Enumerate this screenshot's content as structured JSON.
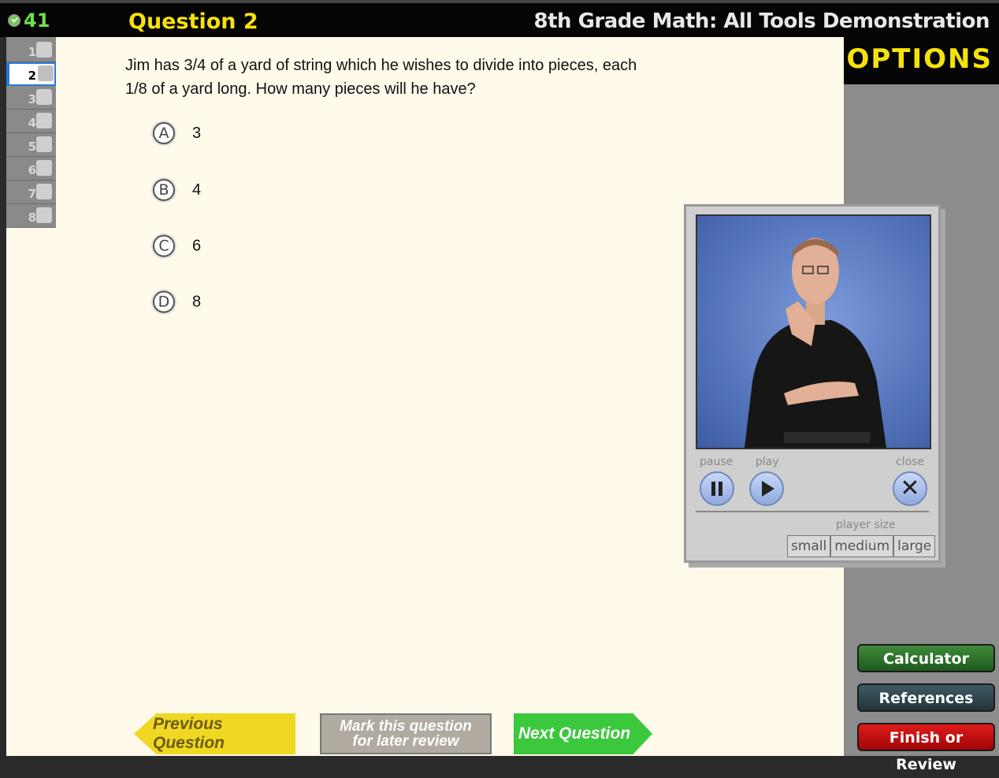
{
  "header": {
    "timer_value": "41",
    "question_title": "Question 2",
    "app_title": "8th Grade Math: All Tools Demonstration"
  },
  "options_label": "OPTIONS",
  "question_nav": [
    "1",
    "2",
    "3",
    "4",
    "5",
    "6",
    "7",
    "8"
  ],
  "active_question": "2",
  "question": {
    "text": "Jim has 3/4 of a yard of string which he wishes to divide into pieces, each 1/8 of a yard long. How many pieces will he have?",
    "answers": [
      {
        "letter": "A",
        "text": "3"
      },
      {
        "letter": "B",
        "text": "4"
      },
      {
        "letter": "C",
        "text": "6"
      },
      {
        "letter": "D",
        "text": "8"
      }
    ]
  },
  "player": {
    "pause_label": "pause",
    "play_label": "play",
    "close_label": "close",
    "player_size_label": "player size",
    "sizes": [
      "small",
      "medium",
      "large"
    ]
  },
  "tools": {
    "calculator": "Calculator",
    "references": "References",
    "finish": "Finish or Review"
  },
  "nav": {
    "previous": "Previous Question",
    "mark_line1": "Mark this question",
    "mark_line2": "for later review",
    "next": "Next Question"
  }
}
